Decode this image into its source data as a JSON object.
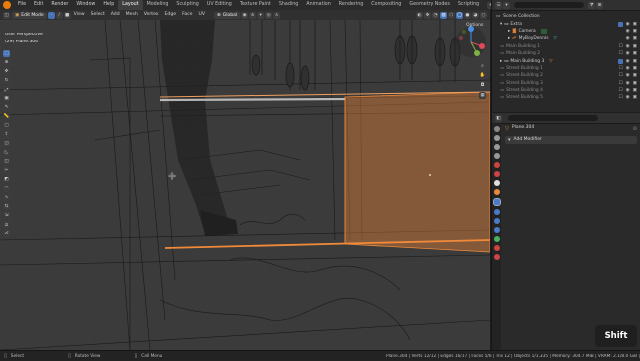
{
  "menu": {
    "items": [
      "File",
      "Edit",
      "Render",
      "Window",
      "Help"
    ],
    "workspaces": [
      "Layout",
      "Modeling",
      "Sculpting",
      "UV Editing",
      "Texture Paint",
      "Shading",
      "Animation",
      "Rendering",
      "Compositing",
      "Geometry Nodes",
      "Scripting"
    ],
    "active_workspace": "Layout",
    "scene": "Scene",
    "view_layer": "ViewLayer"
  },
  "viewport_header": {
    "mode": "Edit Mode",
    "menus": [
      "View",
      "Select",
      "Add",
      "Mesh",
      "Vertex",
      "Edge",
      "Face",
      "UV"
    ],
    "orientation": "Global",
    "options": "Options"
  },
  "viewport": {
    "perspective": "User Perspective",
    "object": "(29) Plane.304",
    "accent_color": "#e8833a"
  },
  "outliner": {
    "root": "Scene Collection",
    "items": [
      {
        "name": "Extra",
        "icon": "collection-icon"
      },
      {
        "name": "Camera",
        "icon": "camera-icon"
      },
      {
        "name": "MyBoyDennis",
        "icon": "armature-icon"
      },
      {
        "name": "Main Building 1",
        "icon": "collection-icon"
      },
      {
        "name": "Main Building 2",
        "icon": "collection-icon"
      },
      {
        "name": "Main Building 3",
        "icon": "collection-icon"
      },
      {
        "name": "Street Building 1",
        "icon": "collection-icon"
      },
      {
        "name": "Street Building 2",
        "icon": "collection-icon"
      },
      {
        "name": "Street Building 3",
        "icon": "collection-icon"
      },
      {
        "name": "Street Building 4",
        "icon": "collection-icon"
      },
      {
        "name": "Street Building 5",
        "icon": "collection-icon"
      }
    ]
  },
  "properties": {
    "object_name": "Plane.304",
    "add_modifier": "Add Modifier"
  },
  "status": {
    "select": "Select",
    "rotate": "Rotate View",
    "call_menu": "Call Menu",
    "stats": "Plane.304 | Verts 12/12 | Edges 16/17 | Faces 5/6 | Tris 12 | Objects 1/1,335 | Memory: 304.7 MiB | VRAM: 2.1/8.0 GiB | 3.3.1"
  },
  "key_overlay": "Shift"
}
